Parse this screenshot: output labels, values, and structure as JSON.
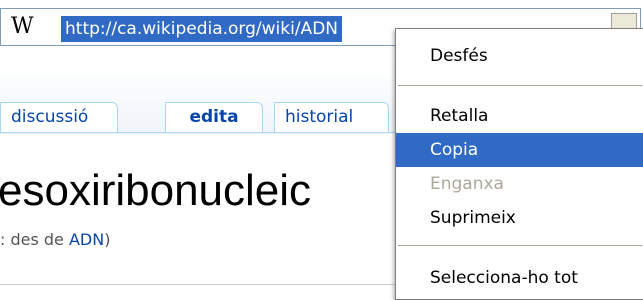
{
  "address_bar": {
    "logo": "W",
    "url": "http://ca.wikipedia.org/wiki/ADN"
  },
  "tabs": [
    {
      "label": "discussió"
    },
    {
      "label": "edita"
    },
    {
      "label": "historial"
    }
  ],
  "page": {
    "title_fragment": "esoxiribonucleic",
    "redirect_prefix": ": des de ",
    "redirect_link": "ADN",
    "redirect_suffix": ")"
  },
  "context_menu": {
    "items": [
      {
        "label": "Desfés",
        "enabled": true,
        "selected": false
      },
      {
        "label": "Retalla",
        "enabled": true,
        "selected": false
      },
      {
        "label": "Copia",
        "enabled": true,
        "selected": true
      },
      {
        "label": "Enganxa",
        "enabled": false,
        "selected": false
      },
      {
        "label": "Suprimeix",
        "enabled": true,
        "selected": false
      },
      {
        "label": "Selecciona-ho tot",
        "enabled": true,
        "selected": false
      }
    ]
  },
  "colors": {
    "selection": "#316ac5",
    "link": "#0645ad",
    "disabled": "#aca899"
  }
}
